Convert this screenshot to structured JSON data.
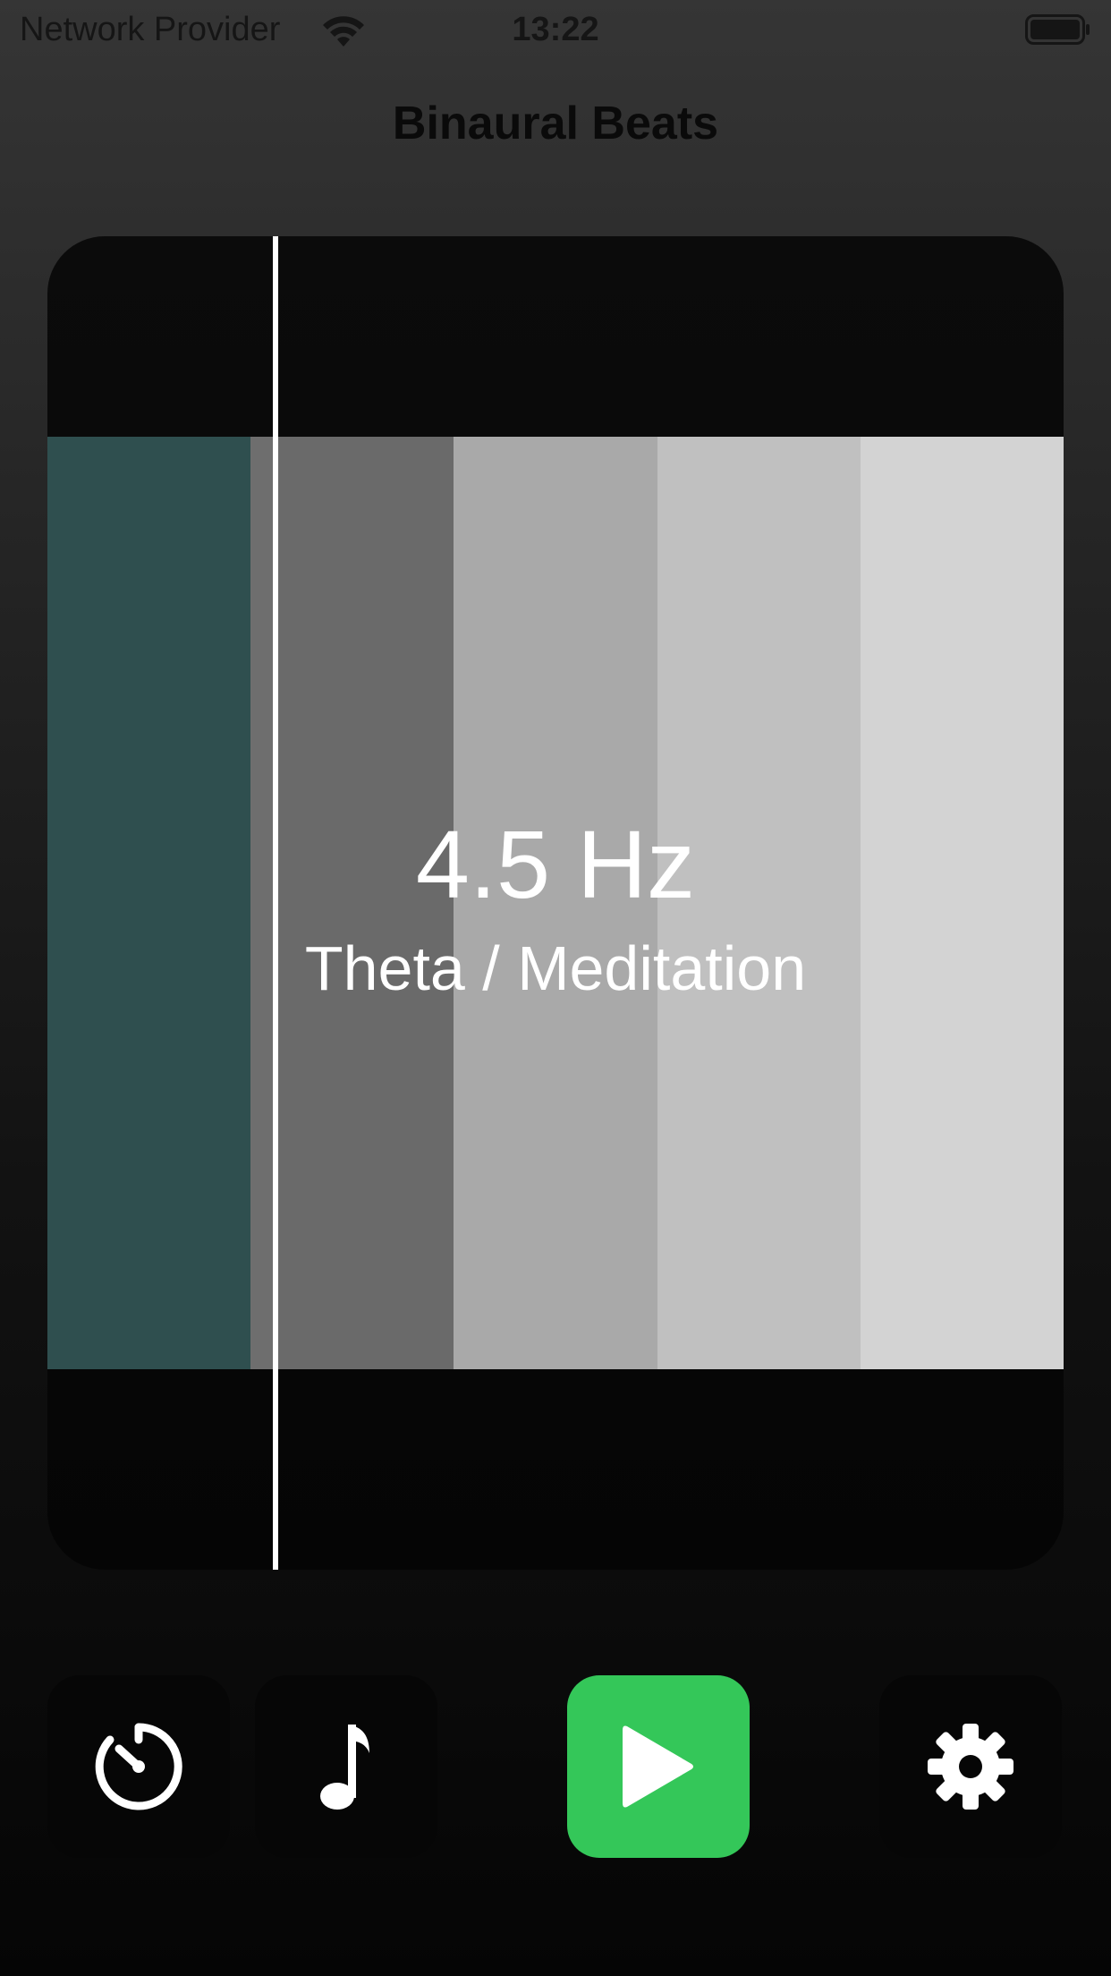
{
  "status_bar": {
    "carrier": "Network Provider",
    "time": "13:22",
    "wifi_icon": "wifi-icon",
    "battery_icon": "battery-icon"
  },
  "nav": {
    "title": "Binaural Beats"
  },
  "visualizer": {
    "frequency": "4.5 Hz",
    "band_label": "Theta / Meditation",
    "bands": [
      {
        "color": "#2f4f4f"
      },
      {
        "color": "#6a6a6a"
      },
      {
        "color": "#a9a9a9"
      },
      {
        "color": "#c0c0c0"
      },
      {
        "color": "#d3d3d3"
      }
    ],
    "active_band_index": 0,
    "active_color": "#2f4f4f"
  },
  "toolbar": {
    "timer_icon": "timer-icon",
    "music_icon": "music-note-icon",
    "play_icon": "play-icon",
    "settings_icon": "gear-icon",
    "play_color": "#34c759"
  }
}
